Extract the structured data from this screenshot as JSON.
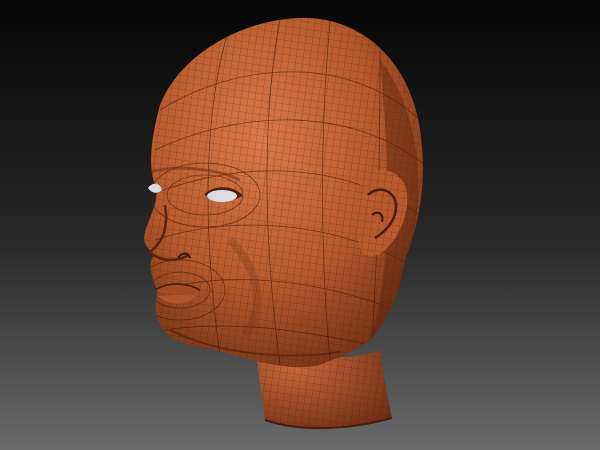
{
  "scene": {
    "subject": "sculpted-head-wireframe-mesh",
    "colors": {
      "background_top": "#050505",
      "background_bottom": "#6a6a6a",
      "skin_light": "#d97a47",
      "skin_mid": "#b75a2e",
      "skin_dark": "#6b2c12",
      "wire": "#3a1406",
      "eye": "#d9dde2"
    }
  }
}
